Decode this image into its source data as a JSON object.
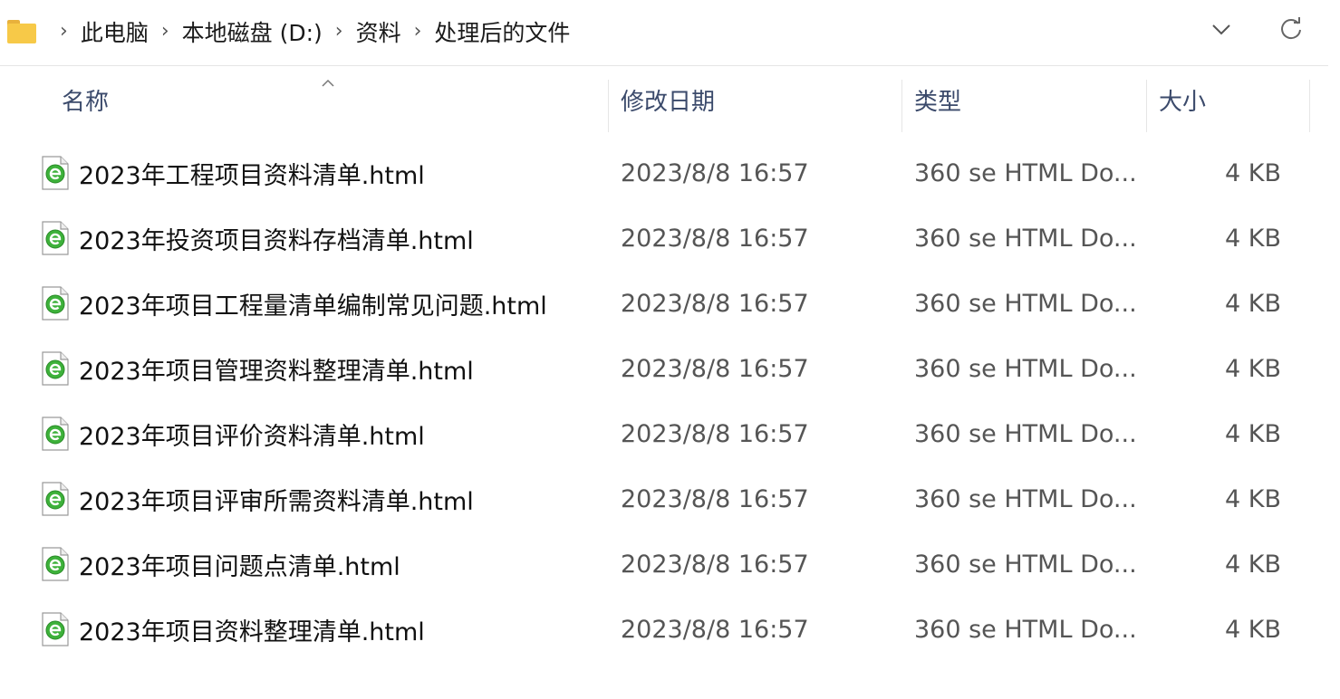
{
  "breadcrumb": {
    "items": [
      "此电脑",
      "本地磁盘 (D:)",
      "资料",
      "处理后的文件"
    ]
  },
  "columns": {
    "name": "名称",
    "date": "修改日期",
    "type": "类型",
    "size": "大小"
  },
  "files": [
    {
      "name": "2023年工程项目资料清单.html",
      "date": "2023/8/8 16:57",
      "type": "360 se HTML Do...",
      "size": "4 KB"
    },
    {
      "name": "2023年投资项目资料存档清单.html",
      "date": "2023/8/8 16:57",
      "type": "360 se HTML Do...",
      "size": "4 KB"
    },
    {
      "name": "2023年项目工程量清单编制常见问题.html",
      "date": "2023/8/8 16:57",
      "type": "360 se HTML Do...",
      "size": "4 KB"
    },
    {
      "name": "2023年项目管理资料整理清单.html",
      "date": "2023/8/8 16:57",
      "type": "360 se HTML Do...",
      "size": "4 KB"
    },
    {
      "name": "2023年项目评价资料清单.html",
      "date": "2023/8/8 16:57",
      "type": "360 se HTML Do...",
      "size": "4 KB"
    },
    {
      "name": "2023年项目评审所需资料清单.html",
      "date": "2023/8/8 16:57",
      "type": "360 se HTML Do...",
      "size": "4 KB"
    },
    {
      "name": "2023年项目问题点清单.html",
      "date": "2023/8/8 16:57",
      "type": "360 se HTML Do...",
      "size": "4 KB"
    },
    {
      "name": "2023年项目资料整理清单.html",
      "date": "2023/8/8 16:57",
      "type": "360 se HTML Do...",
      "size": "4 KB"
    }
  ],
  "icons": {
    "folder": "folder-icon",
    "file": "html-file-icon",
    "dropdown": "chevron-down-icon",
    "refresh": "refresh-icon",
    "sort": "sort-ascending-icon"
  },
  "colors": {
    "header_text": "#3b4a6b",
    "secondary_text": "#555555",
    "folder": "#f7c948",
    "file_icon_green": "#3db13a"
  }
}
